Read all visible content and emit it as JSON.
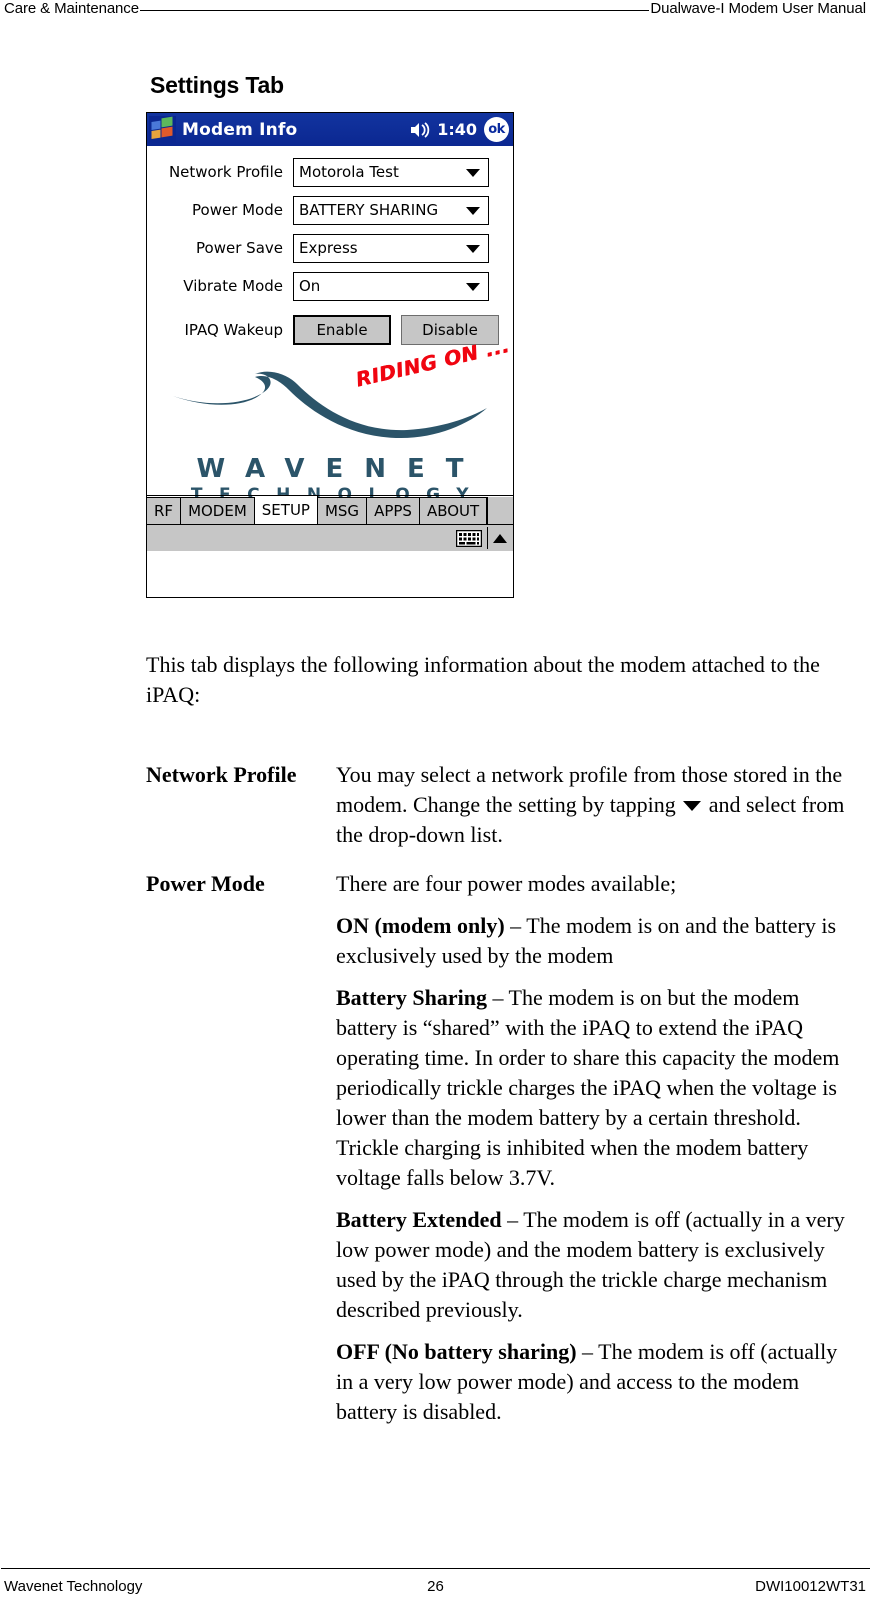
{
  "header": {
    "left": "Care & Maintenance",
    "right": "Dualwave-I Modem User Manual"
  },
  "section": {
    "title": "Settings Tab"
  },
  "pda": {
    "titlebar": {
      "start_icon": "windows-flag-icon",
      "title": "Modem Info",
      "speaker_icon": "speaker-icon",
      "time": "1:40",
      "ok_label": "ok"
    },
    "fields": [
      {
        "label": "Network Profile",
        "value": "Motorola Test",
        "arrow_icon": "chevron-down-icon"
      },
      {
        "label": "Power Mode",
        "value": "BATTERY SHARING",
        "arrow_icon": "chevron-down-icon"
      },
      {
        "label": "Power Save",
        "value": "Express",
        "arrow_icon": "chevron-down-icon"
      },
      {
        "label": "Vibrate Mode",
        "value": "On",
        "arrow_icon": "chevron-down-icon"
      }
    ],
    "wakeup": {
      "label": "IPAQ Wakeup",
      "enable_label": "Enable",
      "disable_label": "Disable"
    },
    "logo": {
      "tagline": "RIDING ON ...",
      "line1": "WAVENET",
      "line2": "TECHNOLOGY",
      "brand_color": "#2b5469",
      "tagline_color": "#f00510"
    },
    "tabs": [
      {
        "label": "RF",
        "active": false
      },
      {
        "label": "MODEM",
        "active": false
      },
      {
        "label": "SETUP",
        "active": true
      },
      {
        "label": "MSG",
        "active": false
      },
      {
        "label": "APPS",
        "active": false
      },
      {
        "label": "ABOUT",
        "active": false
      }
    ],
    "sip": {
      "keyboard_icon": "keyboard-icon",
      "arrow_icon": "chevron-up-icon"
    }
  },
  "body": {
    "intro": "This tab displays the following information about the modem attached to the iPAQ:",
    "definitions": [
      {
        "term": "Network Profile",
        "paragraphs": [
          {
            "pre_text": "You may select a network profile from those stored in the modem. Change the setting by tapping ",
            "has_arrow": true,
            "post_text": " and select from the drop-down list."
          }
        ]
      },
      {
        "term": "Power Mode",
        "paragraphs": [
          {
            "text": "There are four power modes available;"
          },
          {
            "lead": "ON (modem only)",
            "text": " – The modem is on and the battery is exclusively used by the modem"
          },
          {
            "lead": "Battery Sharing",
            "text": " – The modem is on but the modem battery is “shared” with the iPAQ to extend the iPAQ operating time. In order to share this capacity the modem periodically trickle charges the iPAQ when the voltage is lower than the modem battery by a certain threshold. Trickle charging is inhibited when the modem battery voltage falls below 3.7V."
          },
          {
            "lead": "Battery Extended",
            "text": " – The modem is off (actually in a very low power mode) and the modem battery is exclusively used by the iPAQ through the trickle charge mechanism described previously."
          },
          {
            "lead": "OFF (No battery sharing)",
            "text": " – The modem is off (actually in a very low power mode) and access to the modem battery is disabled."
          }
        ]
      }
    ]
  },
  "footer": {
    "left": "Wavenet Technology",
    "page_number": "26",
    "right": "DWI10012WT31"
  }
}
